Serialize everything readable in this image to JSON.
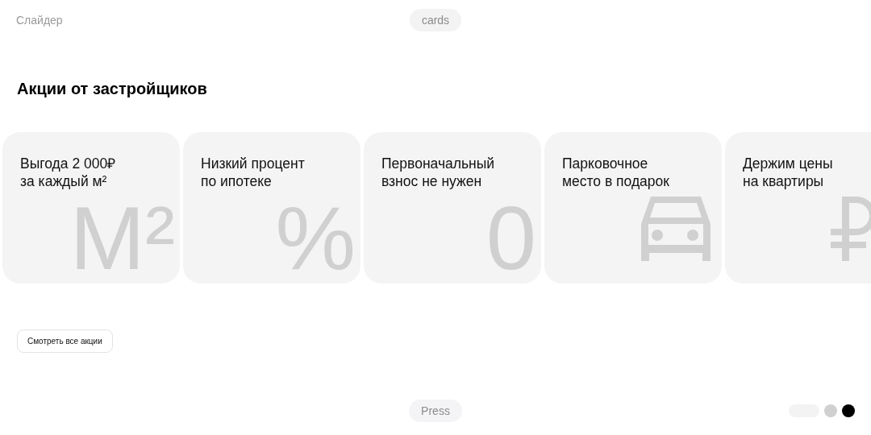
{
  "header": {
    "label": "Слайдер",
    "tag": "cards"
  },
  "title": "Акции от застройщиков",
  "cards": [
    {
      "text": "Выгода 2 000₽\nза каждый м²",
      "kind": "glyph",
      "glyph": "M²"
    },
    {
      "text": "Низкий процент\nпо ипотеке",
      "kind": "glyph",
      "glyph": "%"
    },
    {
      "text": "Первоначальный\nвзнос не нужен",
      "kind": "glyph",
      "glyph": "0"
    },
    {
      "text": "Парковочное\nместо в подарок",
      "kind": "car"
    },
    {
      "text": "Держим цены\nна квартиры",
      "kind": "ruble"
    }
  ],
  "button": "Смотреть все акции",
  "footer": {
    "tag": "Press"
  },
  "pager": [
    {
      "kind": "pill",
      "selected": false
    },
    {
      "kind": "dot",
      "selected": false
    },
    {
      "kind": "dot",
      "selected": true
    }
  ]
}
